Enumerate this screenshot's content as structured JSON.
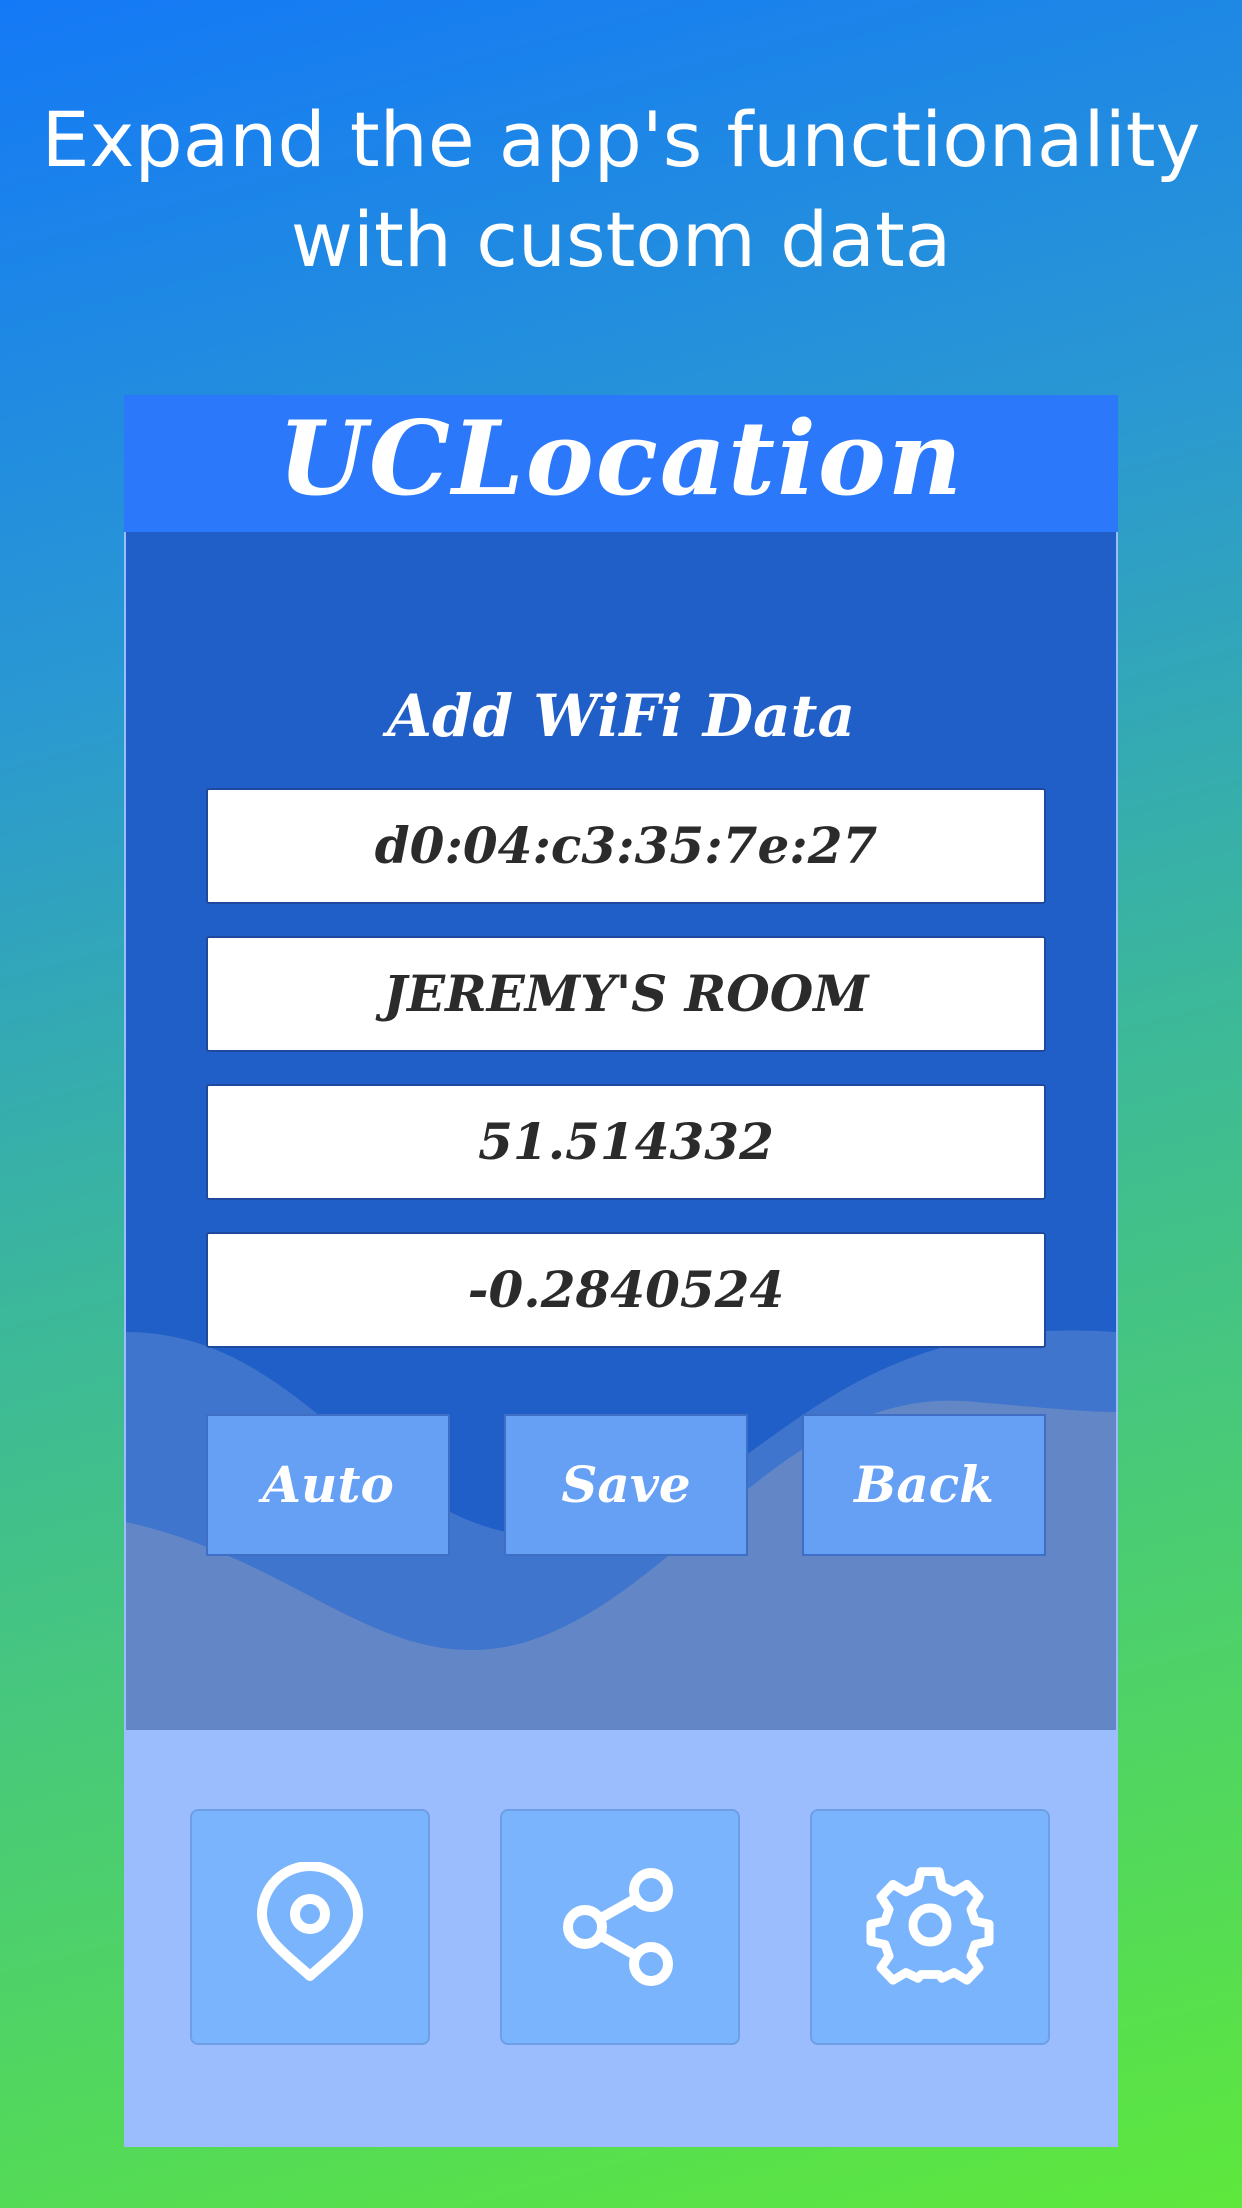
{
  "headline": {
    "line1": "Expand the app's functionality",
    "line2": "with custom data"
  },
  "app": {
    "title": "UCLocation"
  },
  "form": {
    "title": "Add WiFi Data",
    "fields": [
      {
        "value": "d0:04:c3:35:7e:27"
      },
      {
        "value": "JEREMY'S ROOM"
      },
      {
        "value": "51.514332"
      },
      {
        "value": "-0.2840524"
      }
    ],
    "buttons": {
      "auto": "Auto",
      "save": "Save",
      "back": "Back"
    }
  },
  "nav": {
    "items": [
      {
        "icon": "location-pin-icon"
      },
      {
        "icon": "share-icon"
      },
      {
        "icon": "gear-icon"
      }
    ]
  },
  "colors": {
    "app_bar": "#2b78fb",
    "panel": "#205ec8",
    "button": "#66a0f4",
    "nav_background": "#9bbdfd",
    "nav_tile": "#7ab4fc"
  }
}
